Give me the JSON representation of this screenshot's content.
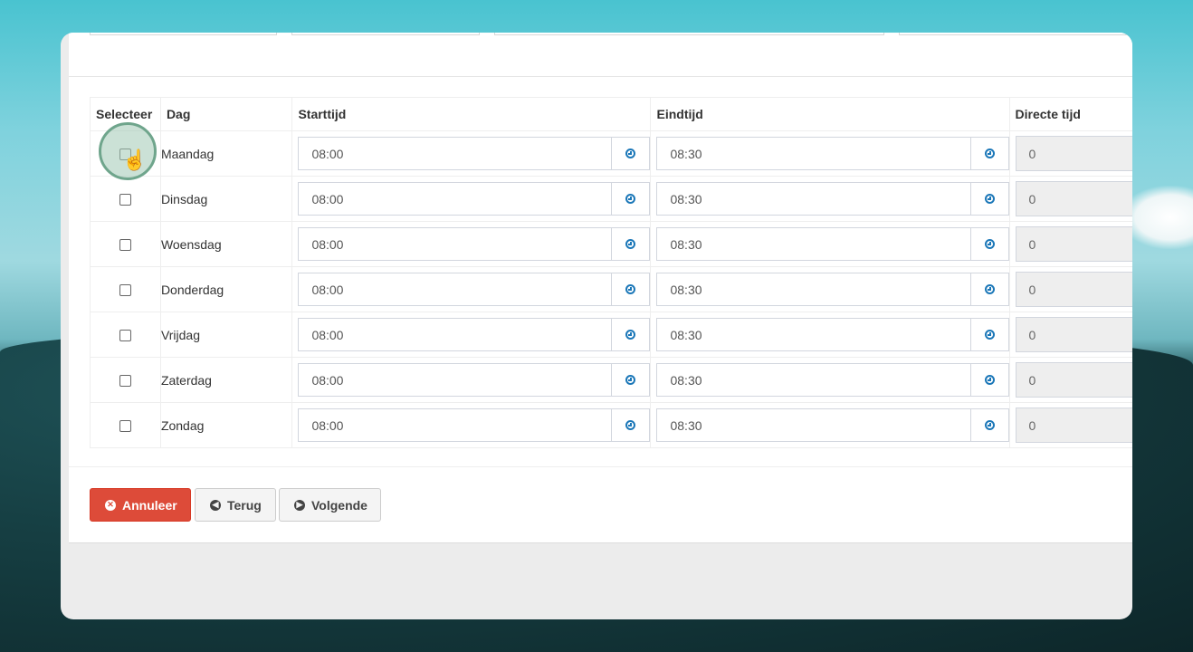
{
  "headers": {
    "select": "Selecteer",
    "day": "Dag",
    "start": "Starttijd",
    "end": "Eindtijd",
    "direct": "Directe tijd"
  },
  "rows": [
    {
      "day": "Maandag",
      "start": "08:00",
      "end": "08:30",
      "direct": "0",
      "checked": false
    },
    {
      "day": "Dinsdag",
      "start": "08:00",
      "end": "08:30",
      "direct": "0",
      "checked": false
    },
    {
      "day": "Woensdag",
      "start": "08:00",
      "end": "08:30",
      "direct": "0",
      "checked": false
    },
    {
      "day": "Donderdag",
      "start": "08:00",
      "end": "08:30",
      "direct": "0",
      "checked": false
    },
    {
      "day": "Vrijdag",
      "start": "08:00",
      "end": "08:30",
      "direct": "0",
      "checked": false
    },
    {
      "day": "Zaterdag",
      "start": "08:00",
      "end": "08:30",
      "direct": "0",
      "checked": false
    },
    {
      "day": "Zondag",
      "start": "08:00",
      "end": "08:30",
      "direct": "0",
      "checked": false
    }
  ],
  "buttons": {
    "cancel": "Annuleer",
    "back": "Terug",
    "next": "Volgende"
  },
  "icons": {
    "cancel": "times-circle-icon",
    "back": "arrow-circle-left-icon",
    "next": "arrow-circle-right-icon",
    "time": "clock-icon"
  },
  "colors": {
    "danger": "#dd4b39",
    "clock": "#1b77b8",
    "cursor_ring": "#6fa58c"
  }
}
